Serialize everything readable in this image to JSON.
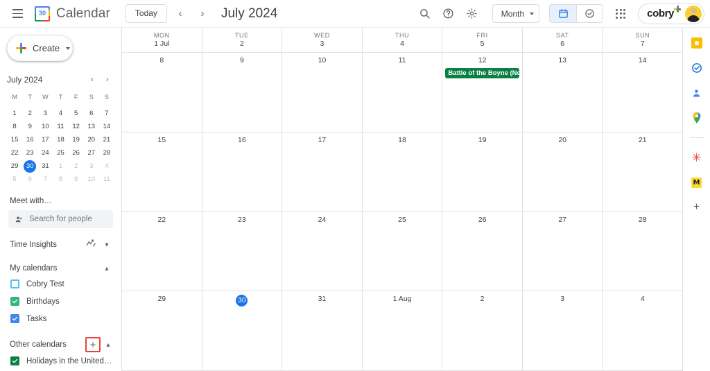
{
  "header": {
    "menu_icon": "hamburger-icon",
    "app_icon": "google-calendar-icon",
    "app_icon_day": "30",
    "brand": "Calendar",
    "today_label": "Today",
    "prev_label": "‹",
    "next_label": "›",
    "period_title": "July 2024",
    "search_icon": "search-icon",
    "help_icon": "help-icon",
    "settings_icon": "gear-icon",
    "view_label": "Month",
    "calendar_view_icon": "calendar-icon",
    "tasks_view_icon": "tasks-check-icon",
    "apps_icon": "google-apps-grid-icon",
    "account_logo": "cobry",
    "avatar_name": "avatar"
  },
  "sidebar": {
    "create_label": "Create",
    "mini_calendar": {
      "title": "July 2024",
      "prev": "‹",
      "next": "›",
      "dow": [
        "M",
        "T",
        "W",
        "T",
        "F",
        "S",
        "S"
      ],
      "weeks": [
        [
          {
            "d": "1"
          },
          {
            "d": "2"
          },
          {
            "d": "3"
          },
          {
            "d": "4"
          },
          {
            "d": "5"
          },
          {
            "d": "6"
          },
          {
            "d": "7"
          }
        ],
        [
          {
            "d": "8"
          },
          {
            "d": "9"
          },
          {
            "d": "10"
          },
          {
            "d": "11"
          },
          {
            "d": "12"
          },
          {
            "d": "13"
          },
          {
            "d": "14"
          }
        ],
        [
          {
            "d": "15"
          },
          {
            "d": "16"
          },
          {
            "d": "17"
          },
          {
            "d": "18"
          },
          {
            "d": "19"
          },
          {
            "d": "20"
          },
          {
            "d": "21"
          }
        ],
        [
          {
            "d": "22"
          },
          {
            "d": "23"
          },
          {
            "d": "24"
          },
          {
            "d": "25"
          },
          {
            "d": "26"
          },
          {
            "d": "27"
          },
          {
            "d": "28"
          }
        ],
        [
          {
            "d": "29"
          },
          {
            "d": "30",
            "today": true
          },
          {
            "d": "31"
          },
          {
            "d": "1",
            "other": true
          },
          {
            "d": "2",
            "other": true
          },
          {
            "d": "3",
            "other": true
          },
          {
            "d": "4",
            "other": true
          }
        ],
        [
          {
            "d": "5",
            "other": true
          },
          {
            "d": "6",
            "other": true
          },
          {
            "d": "7",
            "other": true
          },
          {
            "d": "8",
            "other": true
          },
          {
            "d": "9",
            "other": true
          },
          {
            "d": "10",
            "other": true
          },
          {
            "d": "11",
            "other": true
          }
        ]
      ]
    },
    "meet_with_label": "Meet with…",
    "search_people_placeholder": "Search for people",
    "time_insights_label": "Time Insights",
    "my_calendars_label": "My calendars",
    "my_calendars": [
      {
        "name": "Cobry Test",
        "state": "unchecked",
        "color": "#4fc3f7"
      },
      {
        "name": "Birthdays",
        "state": "checked",
        "color": "#33b679"
      },
      {
        "name": "Tasks",
        "state": "checked",
        "color": "#4285f4"
      }
    ],
    "other_calendars_label": "Other calendars",
    "add_other_calendar_label": "+",
    "other_calendars": [
      {
        "name": "Holidays in the United Kin…",
        "state": "checked",
        "color": "#0b8043"
      }
    ]
  },
  "grid": {
    "day_headers": [
      {
        "dow": "MON",
        "num": "1 Jul"
      },
      {
        "dow": "TUE",
        "num": "2"
      },
      {
        "dow": "WED",
        "num": "3"
      },
      {
        "dow": "THU",
        "num": "4"
      },
      {
        "dow": "FRI",
        "num": "5"
      },
      {
        "dow": "SAT",
        "num": "6"
      },
      {
        "dow": "SUN",
        "num": "7"
      }
    ],
    "weeks": [
      [
        {
          "num": "8"
        },
        {
          "num": "9"
        },
        {
          "num": "10"
        },
        {
          "num": "11"
        },
        {
          "num": "12",
          "events": [
            {
              "title": "Battle of the Boyne (Northe",
              "color": "#0b8043"
            }
          ]
        },
        {
          "num": "13"
        },
        {
          "num": "14"
        }
      ],
      [
        {
          "num": "15"
        },
        {
          "num": "16"
        },
        {
          "num": "17"
        },
        {
          "num": "18"
        },
        {
          "num": "19"
        },
        {
          "num": "20"
        },
        {
          "num": "21"
        }
      ],
      [
        {
          "num": "22"
        },
        {
          "num": "23"
        },
        {
          "num": "24"
        },
        {
          "num": "25"
        },
        {
          "num": "26"
        },
        {
          "num": "27"
        },
        {
          "num": "28"
        }
      ],
      [
        {
          "num": "29"
        },
        {
          "num": "30",
          "today": true
        },
        {
          "num": "31"
        },
        {
          "num": "1 Aug"
        },
        {
          "num": "2"
        },
        {
          "num": "3"
        },
        {
          "num": "4"
        }
      ]
    ]
  },
  "rail": {
    "items": [
      {
        "icon": "google-keep-icon"
      },
      {
        "icon": "google-tasks-icon"
      },
      {
        "icon": "google-contacts-icon"
      },
      {
        "icon": "google-maps-icon"
      },
      {
        "divider": true
      },
      {
        "icon": "addon-asterisk-icon",
        "glyph": "✳"
      },
      {
        "icon": "addon-yellow-icon",
        "glyph": "M"
      },
      {
        "icon": "add-addon-icon",
        "glyph": "+"
      }
    ]
  }
}
